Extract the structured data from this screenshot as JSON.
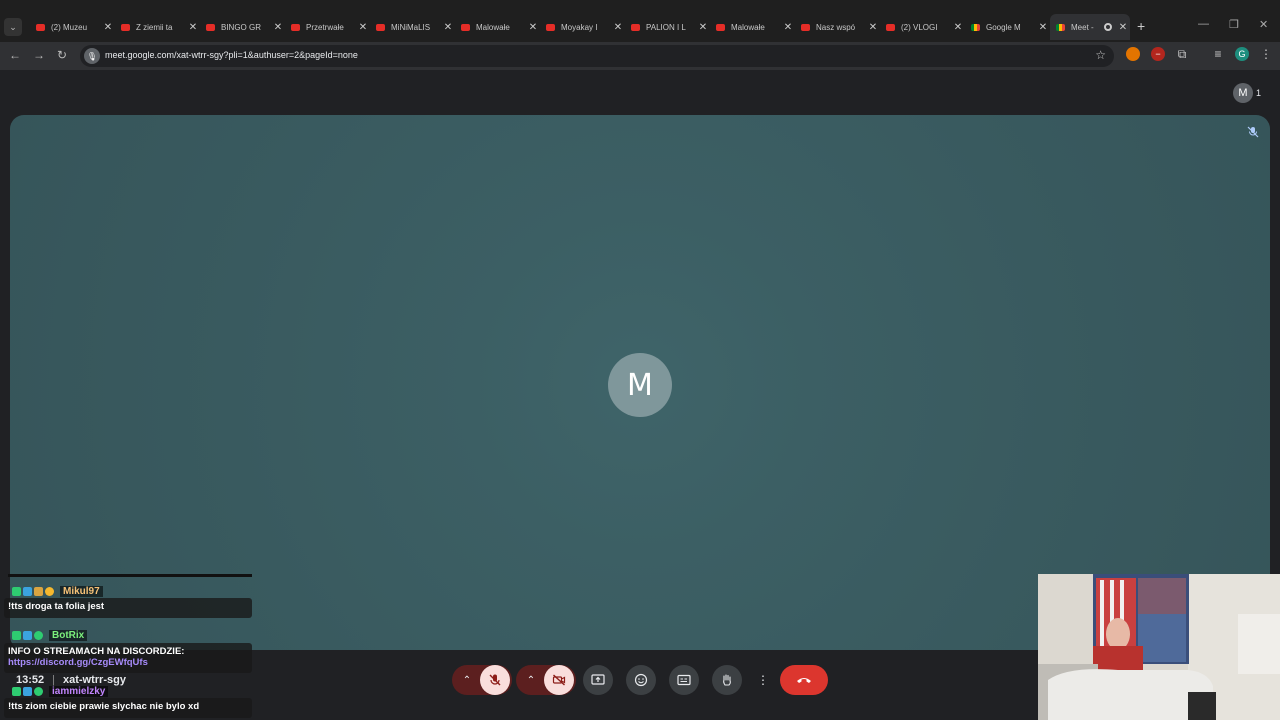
{
  "browser": {
    "tabs": [
      {
        "title": "(2) Muzeu",
        "favicon": "youtube-icon"
      },
      {
        "title": "Z ziemii ta",
        "favicon": "youtube-icon"
      },
      {
        "title": "BINGO GR",
        "favicon": "youtube-icon"
      },
      {
        "title": "Przetrwałe",
        "favicon": "youtube-icon"
      },
      {
        "title": "MiNiMaLIS",
        "favicon": "youtube-icon"
      },
      {
        "title": "Malowałe",
        "favicon": "youtube-icon"
      },
      {
        "title": "Moyakay I",
        "favicon": "youtube-icon"
      },
      {
        "title": "PALION I L",
        "favicon": "youtube-icon"
      },
      {
        "title": "Malowałe",
        "favicon": "youtube-icon"
      },
      {
        "title": "Nasz wspó",
        "favicon": "youtube-icon"
      },
      {
        "title": "(2) VLOGI",
        "favicon": "youtube-icon"
      },
      {
        "title": "Google M",
        "favicon": "meet-icon"
      },
      {
        "title": "Meet -",
        "favicon": "meet-icon",
        "active": true
      }
    ],
    "url": "meet.google.com/xat-wtrr-sgy?pli=1&authuser=2&pageId=none",
    "profile_initial": "G"
  },
  "meet": {
    "participant_initial": "M",
    "participant_count": "1",
    "meeting_time": "13:52",
    "meeting_code": "xat-wtrr-sgy",
    "colors": {
      "tile": "#3c5f64",
      "avatar": "#7f979b",
      "hangup": "#dc362e",
      "muted": "#f9dedc"
    }
  },
  "chat": [
    {
      "user": "Mikul97",
      "user_color": "#f6c177",
      "text": "!tts droga ta folia jest"
    },
    {
      "user": "BotRix",
      "user_color": "#7cf07c",
      "text": "INFO O STREAMACH NA DISCORDZIE:",
      "link": "https://discord.gg/CzgEWfqUfs"
    },
    {
      "user": "iammielzky",
      "user_color": "#c084fc",
      "text": "!tts ziom ciebie prawie slychac nie bylo xd"
    }
  ]
}
